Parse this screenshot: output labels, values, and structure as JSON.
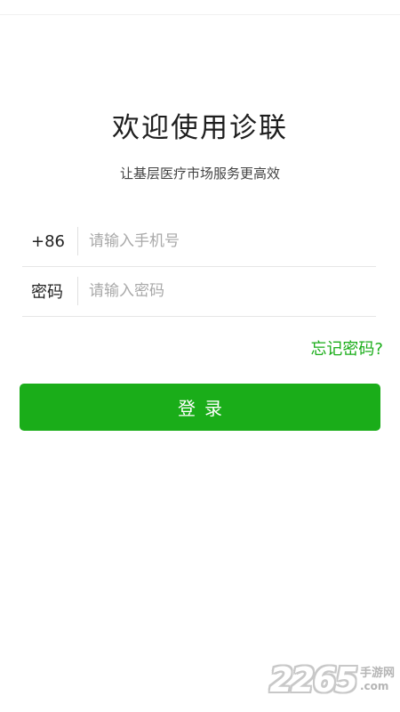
{
  "header": {
    "title": "欢迎使用诊联",
    "subtitle": "让基层医疗市场服务更高效"
  },
  "form": {
    "phone": {
      "label": "+86",
      "placeholder": "请输入手机号",
      "value": ""
    },
    "password": {
      "label": "密码",
      "placeholder": "请输入密码",
      "value": ""
    },
    "forgot_label": "忘记密码?",
    "login_label": "登录"
  },
  "watermark": {
    "number": "2265",
    "text": "手游网",
    "domain": ".com"
  },
  "colors": {
    "accent": "#1aad19",
    "background": "#ffffff",
    "placeholder": "#a9a9a9"
  }
}
